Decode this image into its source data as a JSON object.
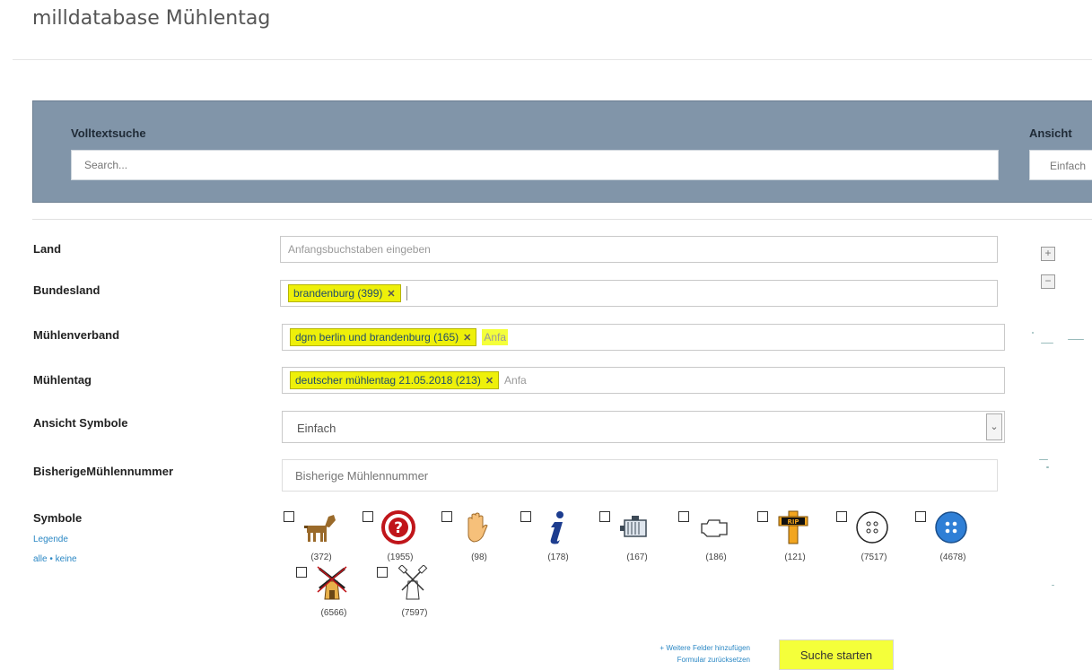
{
  "header": {
    "title": "milldatabase Mühlentag"
  },
  "search_panel": {
    "fulltext_label": "Volltextsuche",
    "fulltext_placeholder": "Search...",
    "view_label": "Ansicht",
    "view_value": "Einfach"
  },
  "fields": {
    "land": {
      "label": "Land",
      "placeholder": "Anfangsbuchstaben eingeben"
    },
    "bundesland": {
      "label": "Bundesland",
      "tag": "brandenburg (399)"
    },
    "muehlenverband": {
      "label": "Mühlenverband",
      "tag": "dgm berlin und brandenburg (165)",
      "ghost": "Anfa"
    },
    "muehlentag": {
      "label": "Mühlentag",
      "tag": "deutscher mühlentag 21.05.2018 (213)",
      "ghost": "Anfa"
    },
    "ansicht_symbole": {
      "label": "Ansicht Symbole",
      "value": "Einfach"
    },
    "bisherige": {
      "label": "BisherigeMühlennummer",
      "placeholder": "Bisherige Mühlennummer"
    }
  },
  "symbols": {
    "label": "Symbole",
    "legend_link": "Legende",
    "all_link": "alle",
    "separator": "•",
    "none_link": "keine",
    "items": [
      {
        "icon": "horse-icon",
        "count": "(372)"
      },
      {
        "icon": "question-icon",
        "count": "(1955)"
      },
      {
        "icon": "hand-icon",
        "count": "(98)"
      },
      {
        "icon": "info-icon",
        "count": "(178)"
      },
      {
        "icon": "engine-icon",
        "count": "(167)"
      },
      {
        "icon": "motor-outline-icon",
        "count": "(186)"
      },
      {
        "icon": "rip-cross-icon",
        "count": "(121)"
      },
      {
        "icon": "button-white-icon",
        "count": "(7517)"
      },
      {
        "icon": "button-blue-icon",
        "count": "(4678)"
      },
      {
        "icon": "crossed-mill-icon",
        "count": "(6566)"
      },
      {
        "icon": "mill-outline-icon",
        "count": "(7597)"
      }
    ]
  },
  "map_controls": {
    "zoom_in": "+",
    "zoom_out": "−"
  },
  "footer": {
    "more_fields": "+ Weitere Felder hinzufügen",
    "reset_form": "Formular zurücksetzen",
    "submit": "Suche starten"
  }
}
